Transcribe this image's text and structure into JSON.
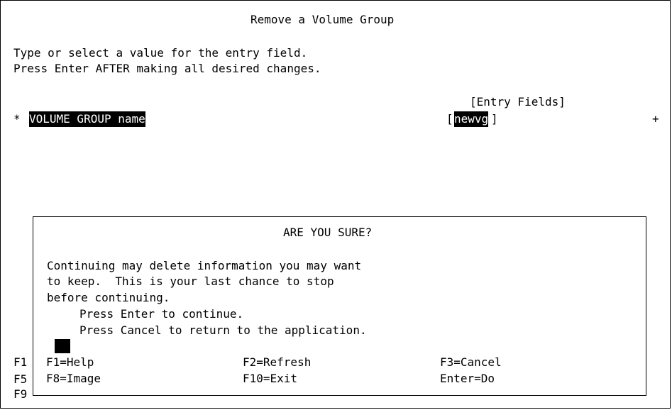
{
  "screen": {
    "title": "Remove a Volume Group",
    "instructions": [
      "Type or select a value for the entry field.",
      "Press Enter AFTER making all desired changes."
    ],
    "entry_fields_header": "[Entry Fields]",
    "field": {
      "required_marker": "*",
      "label": "VOLUME GROUP name",
      "open_bracket": "[",
      "value": "newvg",
      "close_bracket": "]",
      "list_marker": "+"
    },
    "outer_function_keys": [
      "F1",
      "F5",
      "F9"
    ]
  },
  "dialog": {
    "title": "ARE YOU SURE?",
    "message_lines": [
      "Continuing may delete information you may want",
      "to keep.  This is your last chance to stop",
      "before continuing."
    ],
    "prompt_continue": "Press Enter to continue.",
    "prompt_cancel": "Press Cancel to return to the application.",
    "keys": {
      "help": "F1=Help",
      "refresh": "F2=Refresh",
      "cancel": "F3=Cancel",
      "image": "F8=Image",
      "exit": "F10=Exit",
      "do": "Enter=Do"
    }
  }
}
